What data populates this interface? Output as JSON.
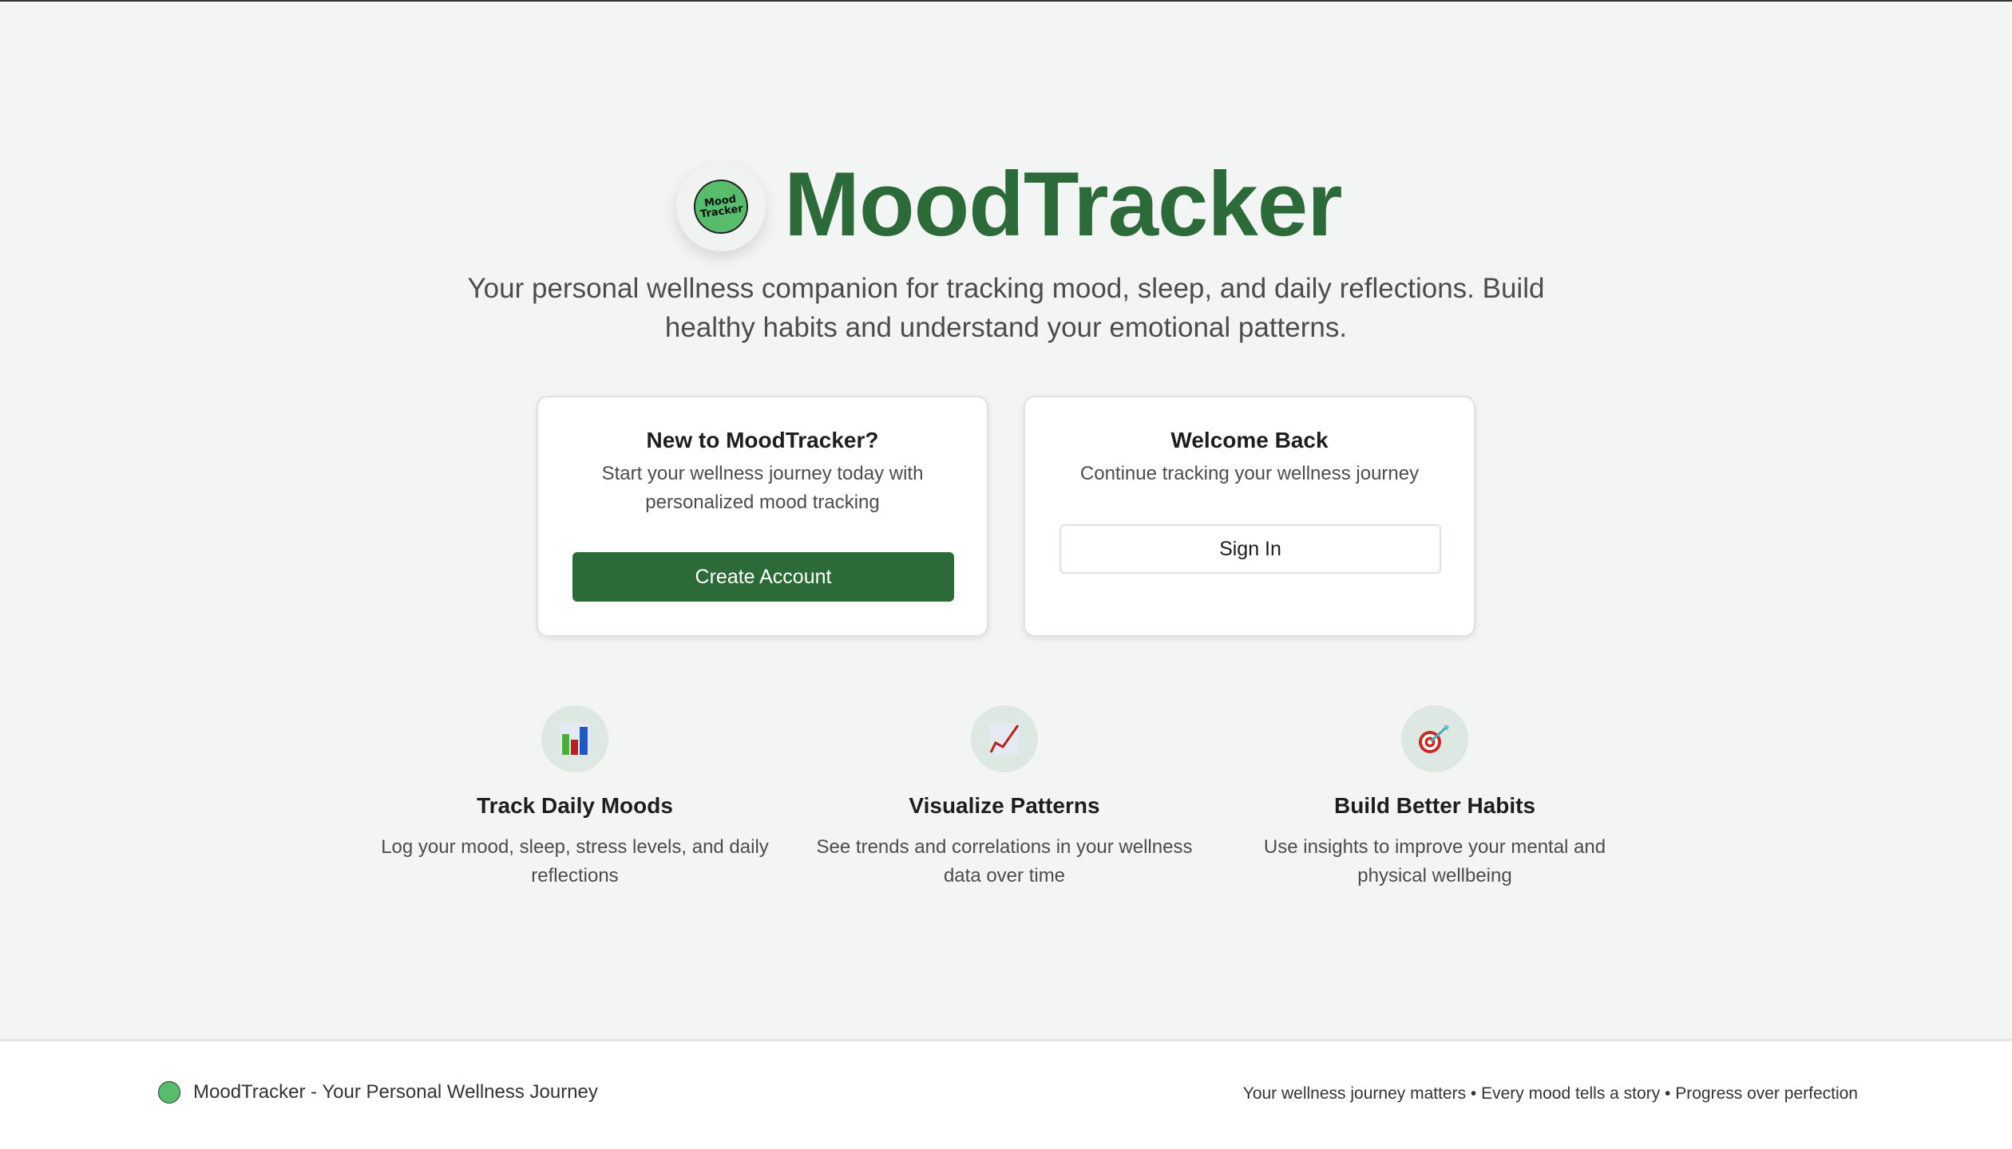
{
  "hero": {
    "logo_text_1": "Mood",
    "logo_text_2": "Tracker",
    "title": "MoodTracker",
    "subtitle": "Your personal wellness companion for tracking mood, sleep, and daily reflections. Build healthy habits and understand your emotional patterns."
  },
  "cards": {
    "new": {
      "title": "New to MoodTracker?",
      "description": "Start your wellness journey today with personalized mood tracking",
      "button": "Create Account"
    },
    "returning": {
      "title": "Welcome Back",
      "description": "Continue tracking your wellness journey",
      "button": "Sign In"
    }
  },
  "features": [
    {
      "icon": "bar-chart-icon",
      "title": "Track Daily Moods",
      "description": "Log your mood, sleep, stress levels, and daily reflections"
    },
    {
      "icon": "trend-chart-icon",
      "title": "Visualize Patterns",
      "description": "See trends and correlations in your wellness data over time"
    },
    {
      "icon": "target-icon",
      "title": "Build Better Habits",
      "description": "Use insights to improve your mental and physical wellbeing"
    }
  ],
  "footer": {
    "left": "MoodTracker - Your Personal Wellness Journey",
    "right": "Your wellness journey matters • Every mood tells a story • Progress over perfection"
  },
  "colors": {
    "brand": "#2d6a3a",
    "logo_green": "#57bd6c",
    "background": "#f3f5f4"
  }
}
